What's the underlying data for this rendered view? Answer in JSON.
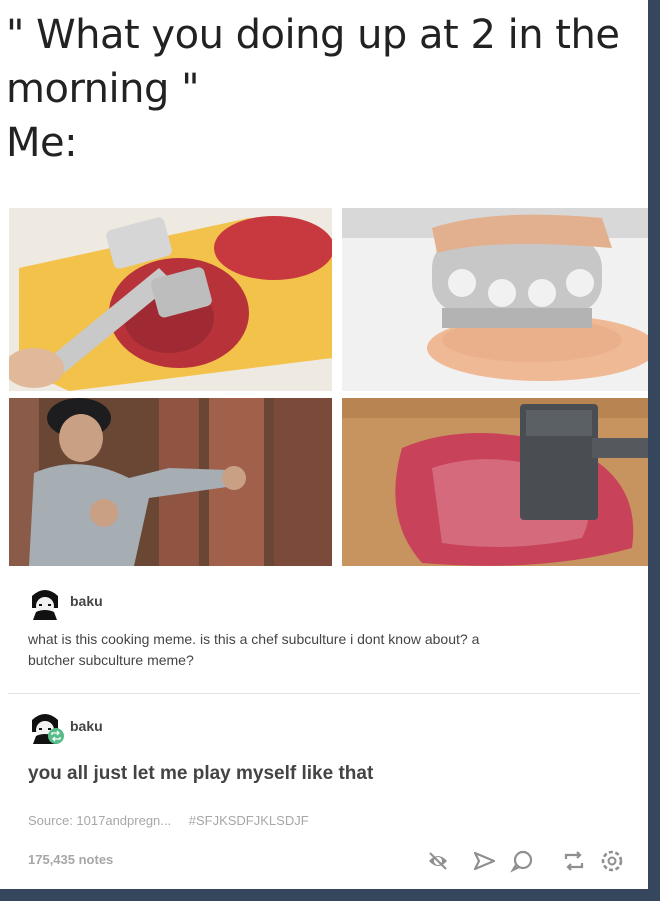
{
  "meme": {
    "line1": "\" What you doing up at 2 in the",
    "line2": "morning \"",
    "line3": "Me:"
  },
  "images": [
    {
      "name": "meat-tenderizer-cutting-board-photo",
      "description": "meat mallet on steak"
    },
    {
      "name": "knuckle-tenderizer-chicken-photo",
      "description": "knuckle tenderizer on chicken"
    },
    {
      "name": "boxer-punching-meat-photo",
      "description": "boxer punching hanging meat"
    },
    {
      "name": "mallet-on-steak-photo",
      "description": "tenderizer on raw steak"
    }
  ],
  "posts": [
    {
      "username": "baku",
      "text_line1": "what is this cooking meme. is this a chef subculture i dont know about? a",
      "text_line2": "butcher subculture meme?"
    },
    {
      "username": "baku",
      "text": "you all just let me play myself like that"
    }
  ],
  "footer": {
    "source_label": "Source: 1017andpregn...",
    "tag": "#SFJKSDFJKLSDJF",
    "notes": "175,435 notes"
  },
  "actions": [
    "view-icon",
    "share-icon",
    "reply-icon",
    "reblog-icon",
    "settings-icon"
  ],
  "colors": {
    "background": "#36465d",
    "card": "#ffffff",
    "text": "#444444",
    "muted": "#a7a7a7",
    "reblog_badge": "#56bc8a"
  }
}
